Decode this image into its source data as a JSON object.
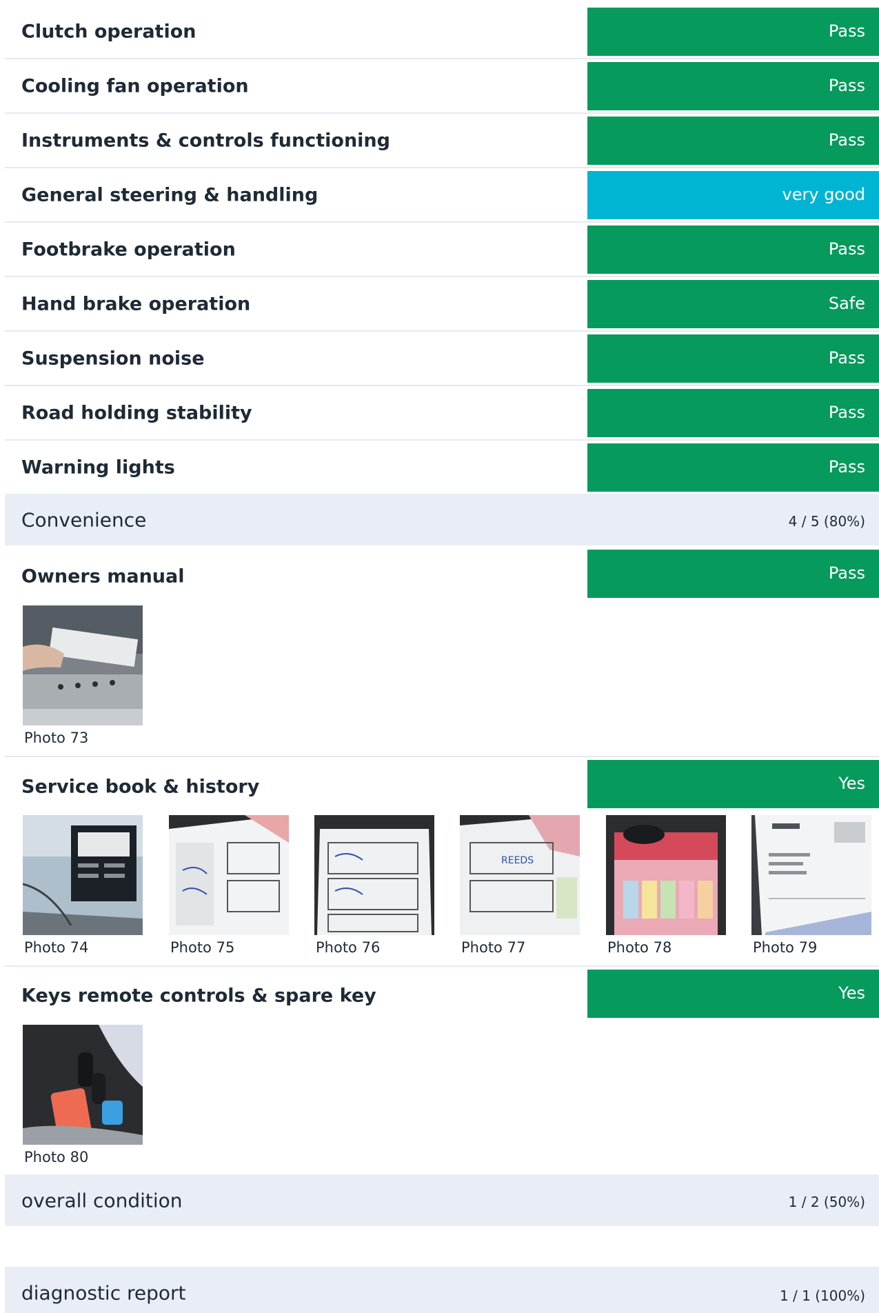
{
  "rows_top": [
    {
      "label": "Clutch operation",
      "result": "Pass"
    },
    {
      "label": "Cooling fan operation",
      "result": "Pass"
    },
    {
      "label": "Instruments & controls functioning",
      "result": "Pass"
    },
    {
      "label": "General steering & handling",
      "result": "very good"
    },
    {
      "label": "Footbrake operation",
      "result": "Pass"
    },
    {
      "label": "Hand brake operation",
      "result": "Safe"
    },
    {
      "label": "Suspension noise",
      "result": "Pass"
    },
    {
      "label": "Road holding stability",
      "result": "Pass"
    },
    {
      "label": "Warning lights",
      "result": "Pass"
    }
  ],
  "convenience": {
    "title": "Convenience",
    "score": "4 / 5 (80%)",
    "owners_manual": {
      "label": "Owners manual",
      "result": "Pass",
      "photos": [
        "Photo 73"
      ]
    },
    "service_book": {
      "label": "Service book & history",
      "result": "Yes",
      "photos": [
        "Photo 74",
        "Photo 75",
        "Photo 76",
        "Photo 77",
        "Photo 78",
        "Photo 79"
      ]
    },
    "keys": {
      "label": "Keys  remote controls & spare key",
      "result": "Yes",
      "photos": [
        "Photo 80"
      ]
    }
  },
  "overall_condition": {
    "title": "overall condition",
    "score": "1 / 2 (50%)"
  },
  "diagnostic_report": {
    "title": "diagnostic report",
    "score": "1 / 1 (100%)"
  },
  "colors": {
    "pass_green": "#069a5d",
    "very_good_cyan": "#00b5d4",
    "section_bg": "#e9edf5"
  }
}
